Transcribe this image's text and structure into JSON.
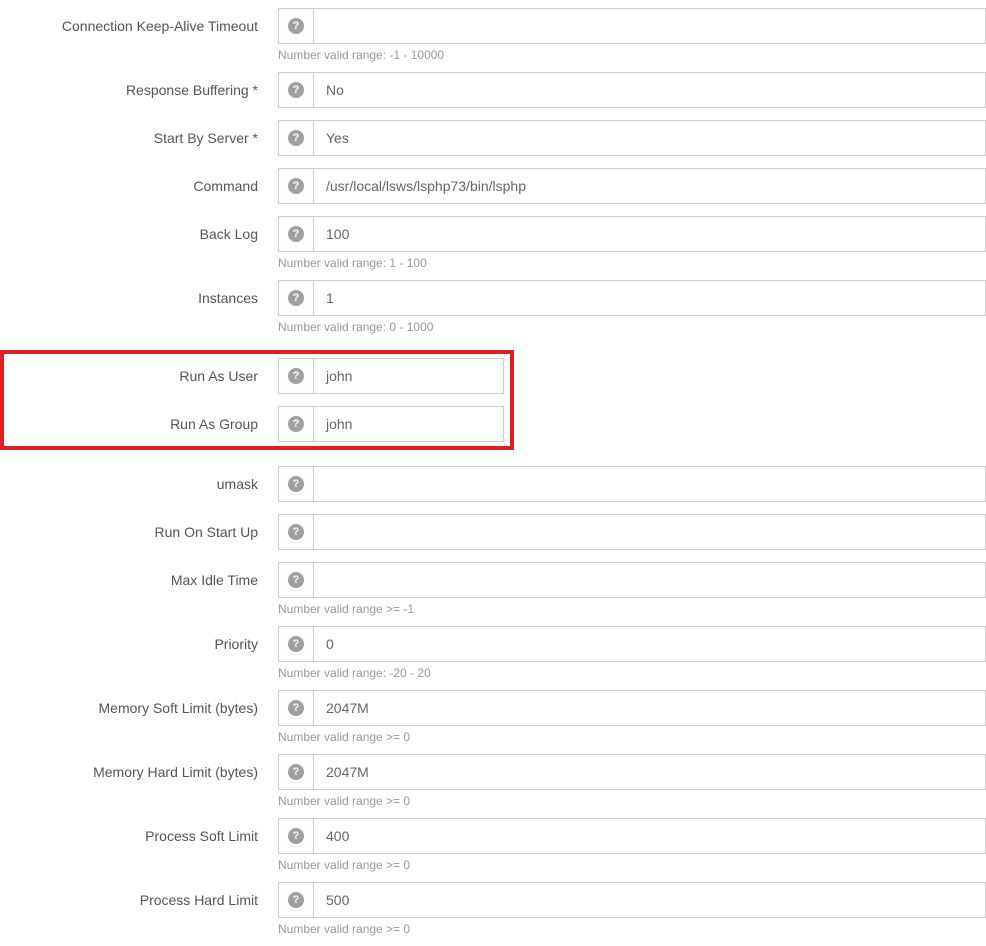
{
  "fields": {
    "connection_keepalive": {
      "label": "Connection Keep-Alive Timeout",
      "value": "",
      "hint": "Number valid range: -1 - 10000"
    },
    "response_buffering": {
      "label": "Response Buffering *",
      "value": "No"
    },
    "start_by_server": {
      "label": "Start By Server *",
      "value": "Yes"
    },
    "command": {
      "label": "Command",
      "value": "/usr/local/lsws/lsphp73/bin/lsphp"
    },
    "back_log": {
      "label": "Back Log",
      "value": "100",
      "hint": "Number valid range: 1 - 100"
    },
    "instances": {
      "label": "Instances",
      "value": "1",
      "hint": "Number valid range: 0 - 1000"
    },
    "run_as_user": {
      "label": "Run As User",
      "value": "john"
    },
    "run_as_group": {
      "label": "Run As Group",
      "value": "john"
    },
    "umask": {
      "label": "umask",
      "value": ""
    },
    "run_on_start_up": {
      "label": "Run On Start Up",
      "value": ""
    },
    "max_idle_time": {
      "label": "Max Idle Time",
      "value": "",
      "hint": "Number valid range >= -1"
    },
    "priority": {
      "label": "Priority",
      "value": "0",
      "hint": "Number valid range: -20 - 20"
    },
    "memory_soft_limit": {
      "label": "Memory Soft Limit (bytes)",
      "value": "2047M",
      "hint": "Number valid range >= 0"
    },
    "memory_hard_limit": {
      "label": "Memory Hard Limit (bytes)",
      "value": "2047M",
      "hint": "Number valid range >= 0"
    },
    "process_soft_limit": {
      "label": "Process Soft Limit",
      "value": "400",
      "hint": "Number valid range >= 0"
    },
    "process_hard_limit": {
      "label": "Process Hard Limit",
      "value": "500",
      "hint": "Number valid range >= 0"
    }
  },
  "help_glyph": "?"
}
